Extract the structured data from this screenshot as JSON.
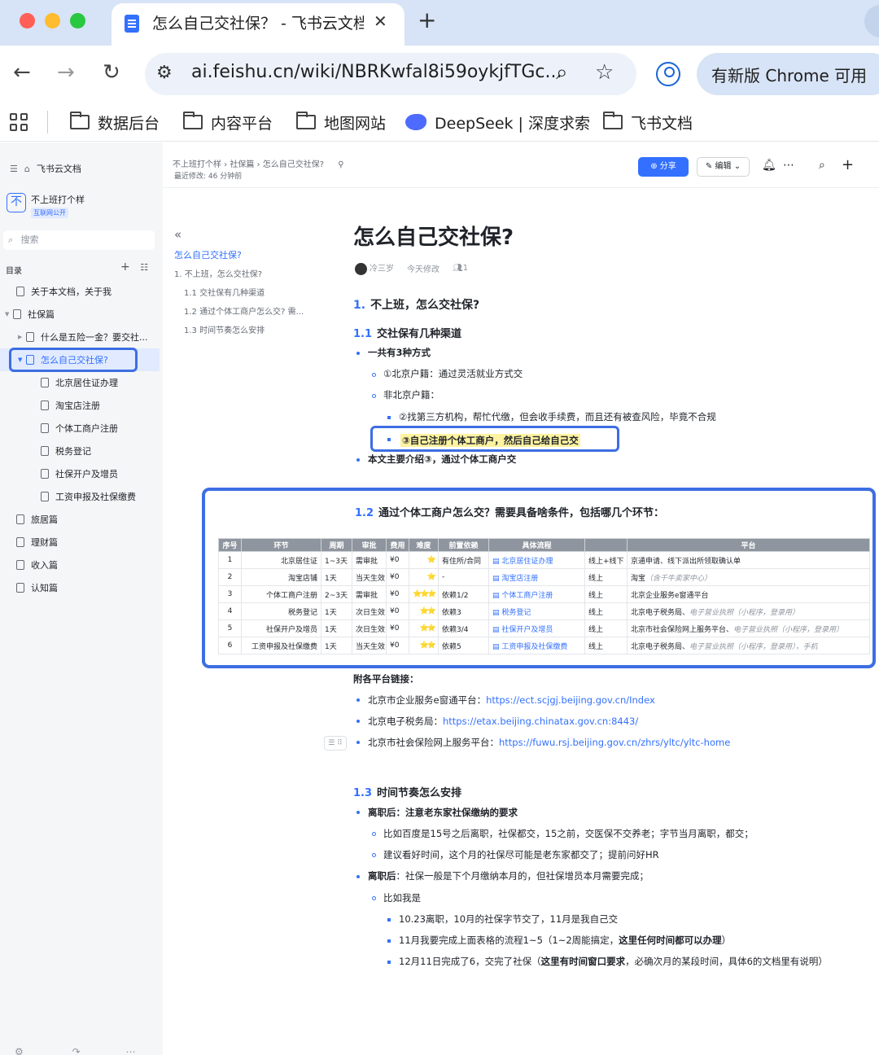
{
  "browser": {
    "tab_title": "怎么自己交社保？ - 飞书云文档",
    "url": "ai.feishu.cn/wiki/NBRKwfal8i59oykjfTGc...",
    "update_label": "有新版 Chrome 可用",
    "bookmarks": [
      "数据后台",
      "内容平台",
      "地图网站",
      "DeepSeek | 深度求索",
      "飞书文档"
    ]
  },
  "sidebar": {
    "top_label": "飞书云文档",
    "space_logo": "不",
    "space_name": "不上班打个样",
    "space_badge": "互联网公开",
    "search_placeholder": "搜索",
    "toc_label": "目录",
    "items": [
      {
        "label": "关于本文档，关于我"
      },
      {
        "label": "社保篇"
      },
      {
        "label": "什么是五险一金？要交社..."
      },
      {
        "label": "怎么自己交社保?"
      },
      {
        "label": "北京居住证办理"
      },
      {
        "label": "淘宝店注册"
      },
      {
        "label": "个体工商户注册"
      },
      {
        "label": "税务登记"
      },
      {
        "label": "社保开户及增员"
      },
      {
        "label": "工资申报及社保缴费"
      },
      {
        "label": "旅居篇"
      },
      {
        "label": "理财篇"
      },
      {
        "label": "收入篇"
      },
      {
        "label": "认知篇"
      }
    ]
  },
  "header": {
    "breadcrumb": "不上班打个样 › 社保篇 › 怎么自己交社保?",
    "last_edit": "最近修改: 46 分钟前",
    "share_label": "分享",
    "edit_label": "编辑"
  },
  "outline": {
    "title": "怎么自己交社保?",
    "items": [
      "1. 不上班，怎么交社保?",
      "1.1 交社保有几种渠道",
      "1.2 通过个体工商户怎么交? 需...",
      "1.3 时间节奏怎么安排"
    ]
  },
  "doc": {
    "title": "怎么自己交社保?",
    "author": "冷三岁",
    "modified": "今天修改",
    "viewers": "1",
    "h1_num": "1.",
    "h1_text": "不上班，怎么交社保?",
    "h11_num": "1.1",
    "h11_text": "交社保有几种渠道",
    "l1": "一共有3种方式",
    "l1a": "①北京户籍：通过灵活就业方式交",
    "l1b": "非北京户籍：",
    "l1b1": "②找第三方机构，帮忙代缴，但会收手续费，而且还有被查风险，毕竟不合规",
    "l1b2": "③自己注册个体工商户，然后自己给自己交",
    "l2": "本文主要介绍③，通过个体工商户交",
    "h12_num": "1.2",
    "h12_text": "通过个体工商户怎么交？需要具备啥条件，包括哪几个环节：",
    "table": {
      "headers": [
        "序号",
        "环节",
        "周期",
        "审批",
        "费用",
        "难度",
        "前置依赖",
        "具体流程",
        "",
        "平台"
      ],
      "rows": [
        [
          "1",
          "北京居住证",
          "1~3天",
          "需审批",
          "¥0",
          "⭐",
          "有住所/合同",
          "北京居住证办理",
          "线上+线下",
          "京通申请、线下派出所领取确认单",
          ""
        ],
        [
          "2",
          "淘宝店铺",
          "1天",
          "当天生效",
          "¥0",
          "⭐",
          "-",
          "淘宝店注册",
          "线上",
          "淘宝",
          "（含千牛卖家中心）"
        ],
        [
          "3",
          "个体工商户注册",
          "2~3天",
          "需审批",
          "¥0",
          "⭐⭐⭐",
          "依赖1/2",
          "个体工商户注册",
          "线上",
          "北京企业服务e窗通平台",
          ""
        ],
        [
          "4",
          "税务登记",
          "1天",
          "次日生效",
          "¥0",
          "⭐⭐",
          "依赖3",
          "税务登记",
          "线上",
          "北京电子税务局、",
          "电子营业执照（小程序，登录用）"
        ],
        [
          "5",
          "社保开户及增员",
          "1天",
          "次日生效",
          "¥0",
          "⭐⭐",
          "依赖3/4",
          "社保开户及增员",
          "线上",
          "北京市社会保险网上服务平台、",
          "电子营业执照（小程序，登录用）"
        ],
        [
          "6",
          "工资申报及社保缴费",
          "1天",
          "当天生效",
          "¥0",
          "⭐⭐",
          "依赖5",
          "工资申报及社保缴费",
          "线上",
          "北京电子税务局、",
          "电子营业执照（小程序，登录用），手机"
        ]
      ]
    },
    "links_title": "附各平台链接：",
    "links": [
      {
        "label": "北京市企业服务e窗通平台：",
        "url": "https://ect.scjgj.beijing.gov.cn/Index"
      },
      {
        "label": "北京电子税务局：",
        "url": "https://etax.beijing.chinatax.gov.cn:8443/"
      },
      {
        "label": "北京市社会保险网上服务平台：",
        "url": "https://fuwu.rsj.beijing.gov.cn/zhrs/yltc/yltc-home"
      }
    ],
    "h13_num": "1.3",
    "h13_text": "时间节奏怎么安排",
    "t1_bold": "离职后：注意老东家社保缴纳的要求",
    "t1a": "比如百度是15号之后离职，社保都交，15之前，交医保不交养老；字节当月离职，都交；",
    "t1b": "建议看好时间，这个月的社保尽可能是老东家都交了；提前问好HR",
    "t2_bold": "离职后",
    "t2_rest": "：社保一般是下个月缴纳本月的，但社保增员本月需要完成；",
    "t2a": "比如我是",
    "t2a1": "10.23离职，10月的社保字节交了，11月是我自己交",
    "t2a2_a": "11月我要完成上面表格的流程1~5（1~2周能搞定，",
    "t2a2_b": "这里任何时间都可以办理",
    "t2a2_c": "）",
    "t2a3_a": "12月11日完成了6，交完了社保（",
    "t2a3_b": "这里有时间窗口要求",
    "t2a3_c": "，必确次月的某段时间，具体6的文档里有说明）"
  }
}
